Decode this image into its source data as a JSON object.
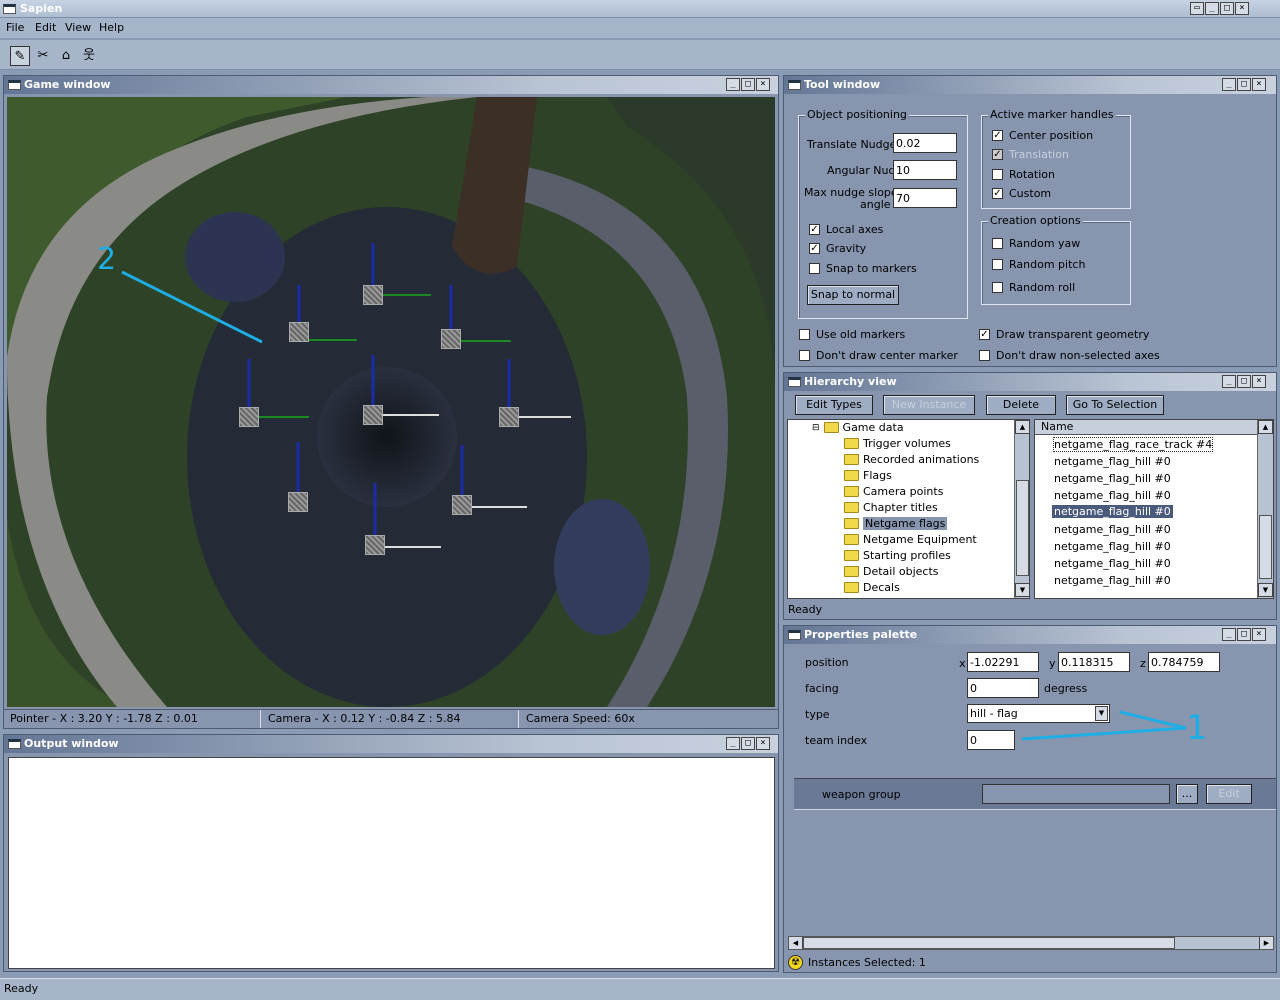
{
  "app": {
    "title": "Sapien"
  },
  "menu": {
    "file": "File",
    "edit": "Edit",
    "view": "View",
    "help": "Help"
  },
  "toolbar": {
    "icons": [
      "pencil-icon",
      "scissors-icon",
      "camera-icon",
      "person-icon"
    ]
  },
  "game_window": {
    "title": "Game window",
    "annotation": "2",
    "status": {
      "pointer": "Pointer - X : 3.20  Y : -1.78  Z : 0.01",
      "camera": "Camera - X : 0.12  Y : -0.84  Z : 5.84",
      "speed": "Camera Speed: 60x"
    }
  },
  "output_window": {
    "title": "Output window"
  },
  "tool_window": {
    "title": "Tool window",
    "object_positioning": {
      "legend": "Object positioning",
      "translate_label": "Translate Nudge",
      "translate_value": "0.02",
      "angular_label": "Angular Nudge",
      "angular_value": "10",
      "slope_label_1": "Max nudge slope",
      "slope_label_2": "angle",
      "slope_value": "70",
      "local_axes": "Local axes",
      "gravity": "Gravity",
      "snap_markers": "Snap to markers",
      "snap_normal": "Snap to normal"
    },
    "marker_handles": {
      "legend": "Active marker handles",
      "center": "Center position",
      "translation": "Translation",
      "rotation": "Rotation",
      "custom": "Custom"
    },
    "creation": {
      "legend": "Creation options",
      "yaw": "Random yaw",
      "pitch": "Random pitch",
      "roll": "Random roll"
    },
    "use_old_markers": "Use old markers",
    "dont_draw_center": "Don't draw center marker",
    "draw_transparent": "Draw transparent geometry",
    "dont_draw_axes": "Don't draw non-selected axes"
  },
  "hierarchy": {
    "title": "Hierarchy view",
    "buttons": {
      "edit_types": "Edit Types",
      "new_instance": "New Instance",
      "delete": "Delete",
      "goto": "Go To Selection"
    },
    "tree_root": "Game data",
    "tree_items": [
      "Trigger volumes",
      "Recorded animations",
      "Flags",
      "Camera points",
      "Chapter titles",
      "Netgame flags",
      "Netgame Equipment",
      "Starting profiles",
      "Detail objects",
      "Decals"
    ],
    "list_header": "Name",
    "list_items": [
      "netgame_flag_race_track #4",
      "netgame_flag_hill #0",
      "netgame_flag_hill #0",
      "netgame_flag_hill #0",
      "netgame_flag_hill #0",
      "netgame_flag_hill #0",
      "netgame_flag_hill #0",
      "netgame_flag_hill #0",
      "netgame_flag_hill #0"
    ],
    "status": "Ready"
  },
  "properties": {
    "title": "Properties palette",
    "position_label": "position",
    "x_label": "x",
    "x": "-1.02291",
    "y_label": "y",
    "y": "0.118315",
    "z_label": "z",
    "z": "0.784759",
    "facing_label": "facing",
    "facing": "0",
    "degrees": "degress",
    "type_label": "type",
    "type": "hill - flag",
    "team_label": "team index",
    "team": "0",
    "annotation": "1",
    "weapon_group": "weapon group",
    "browse": "...",
    "edit": "Edit",
    "instances": "Instances Selected: 1"
  },
  "status_bar": {
    "text": "Ready"
  },
  "colors": {
    "annotation": "#1eaee6",
    "selection": "#4a5a7c"
  }
}
